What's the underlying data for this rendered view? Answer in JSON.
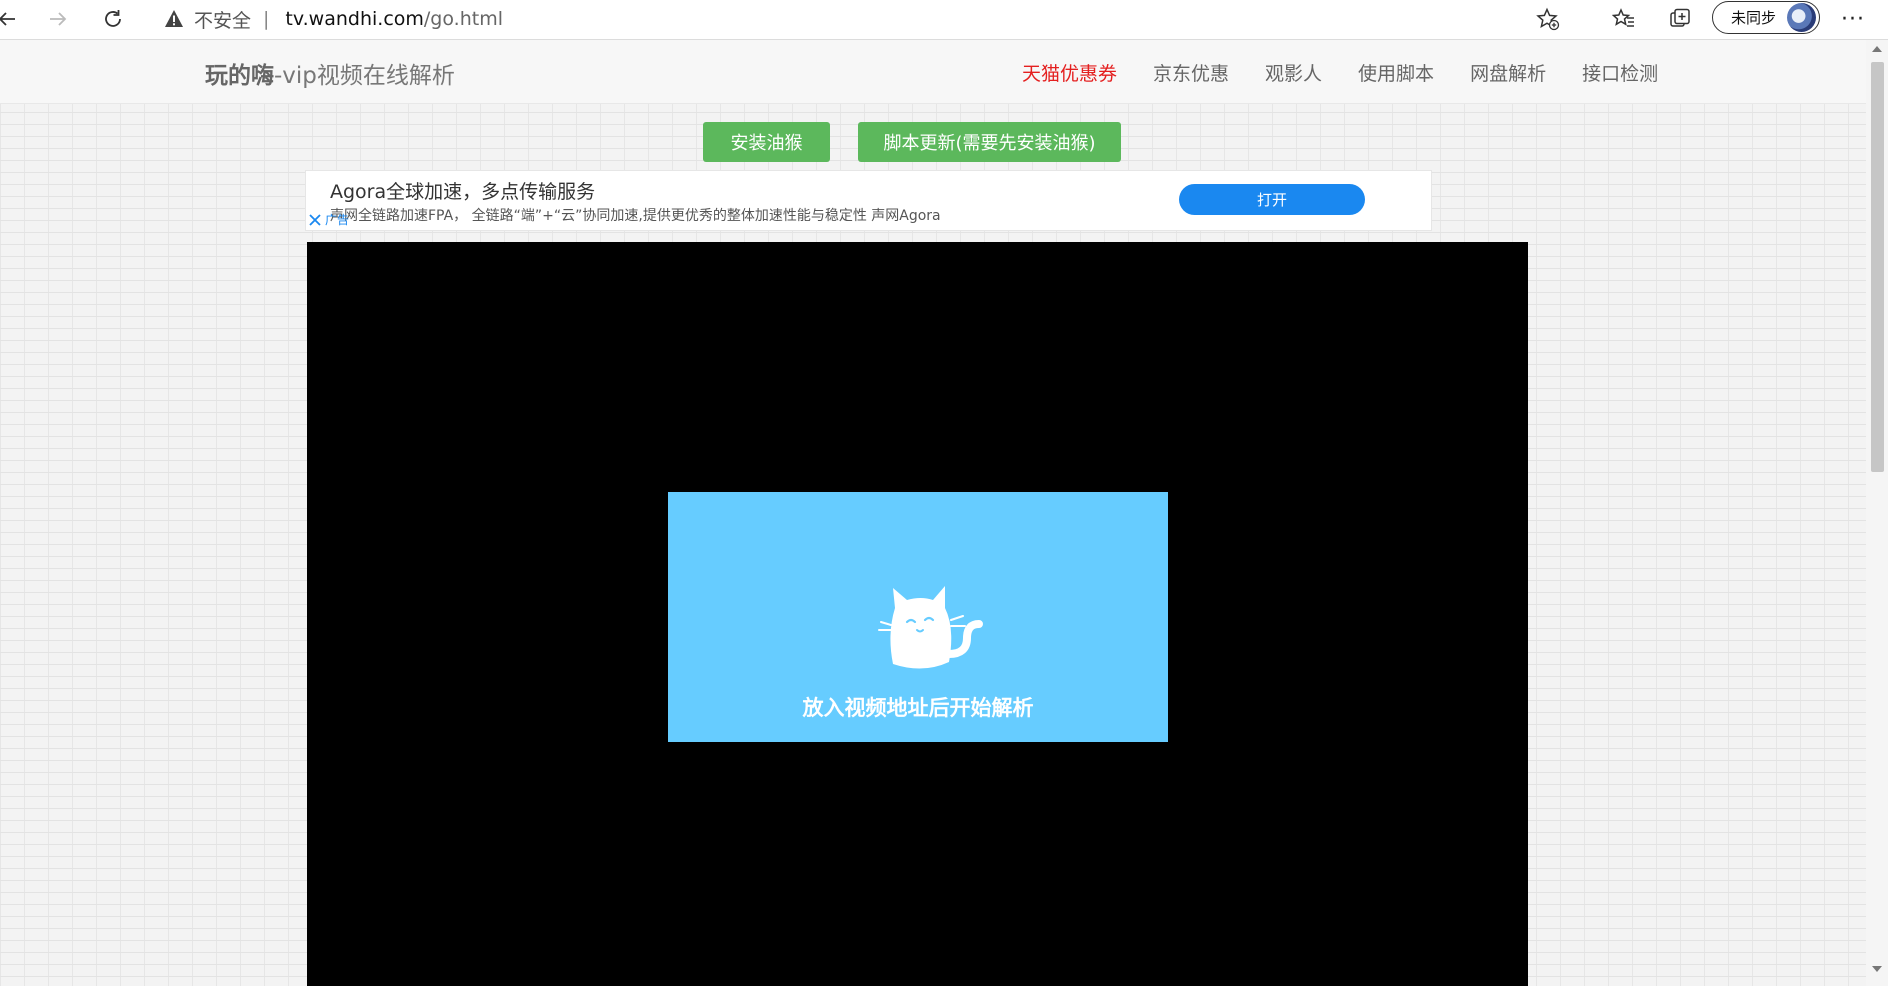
{
  "browser": {
    "insecure_label": "不安全",
    "separator": "|",
    "url_host": "tv.wandhi.com",
    "url_path": "/go.html",
    "profile_label": "未同步",
    "more_label": "···"
  },
  "site": {
    "title_bold": "玩的嗨",
    "title_rest": "-vip视频在线解析",
    "nav": [
      {
        "label": "天猫优惠券",
        "highlight": true
      },
      {
        "label": "京东优惠"
      },
      {
        "label": "观影人"
      },
      {
        "label": "使用脚本"
      },
      {
        "label": "网盘解析"
      },
      {
        "label": "接口检测"
      }
    ],
    "highlight_color": "#e41f1f"
  },
  "buttons": {
    "install": "安装油猴",
    "update": "脚本更新(需要先安装油猴)"
  },
  "ad": {
    "title": "Agora全球加速，多点传输服务",
    "desc": "声网全链路加速FPA， 全链路“端”+“云”协同加速,提供更优秀的整体加速性能与稳定性 声网Agora",
    "open_label": "打开",
    "tag": "广告"
  },
  "player": {
    "message": "放入视频地址后开始解析",
    "card_color": "#66ccff"
  },
  "icons": [
    "back-icon",
    "forward-icon",
    "refresh-icon",
    "warning-icon",
    "add-favorite-icon",
    "favorites-icon",
    "collections-icon",
    "more-icon",
    "close-icon",
    "cat-icon"
  ]
}
